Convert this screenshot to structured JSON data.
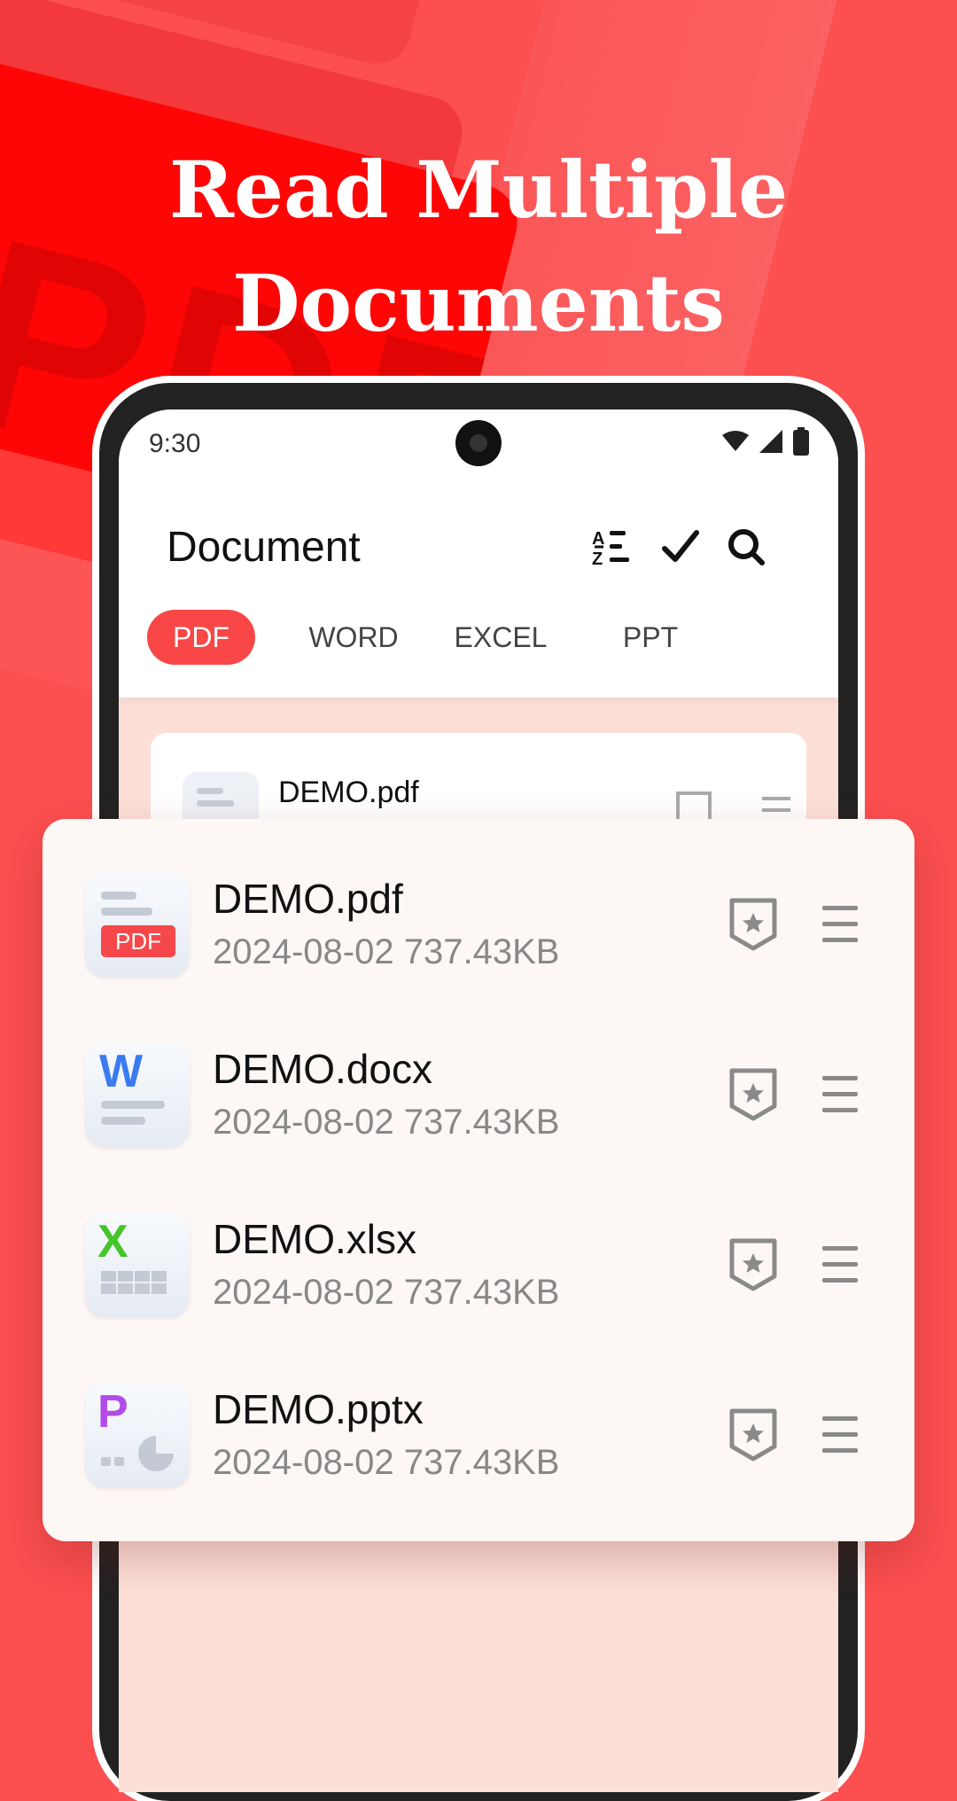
{
  "headline": {
    "line1": "Read Multiple",
    "line2": "Documents"
  },
  "background": {
    "watermark_text": "PDF"
  },
  "status_bar": {
    "time": "9:30"
  },
  "app_bar": {
    "title": "Document"
  },
  "tabs": [
    {
      "label": "PDF",
      "active": true
    },
    {
      "label": "WORD",
      "active": false
    },
    {
      "label": "EXCEL",
      "active": false
    },
    {
      "label": "PPT",
      "active": false
    }
  ],
  "background_list": {
    "first_item_name": "DEMO.pdf"
  },
  "files": [
    {
      "name": "DEMO.pdf",
      "meta": "2024-08-02 737.43KB",
      "type": "pdf",
      "badge": "PDF"
    },
    {
      "name": "DEMO.docx",
      "meta": "2024-08-02 737.43KB",
      "type": "word",
      "badge": "W"
    },
    {
      "name": "DEMO.xlsx",
      "meta": "2024-08-02 737.43KB",
      "type": "excel",
      "badge": "X"
    },
    {
      "name": "DEMO.pptx",
      "meta": "2024-08-02 737.43KB",
      "type": "ppt",
      "badge": "P"
    }
  ],
  "colors": {
    "background": "#fb4f50",
    "accent": "#f94646",
    "word": "#3a7cf0",
    "excel": "#46c52a",
    "ppt": "#b24be8"
  }
}
